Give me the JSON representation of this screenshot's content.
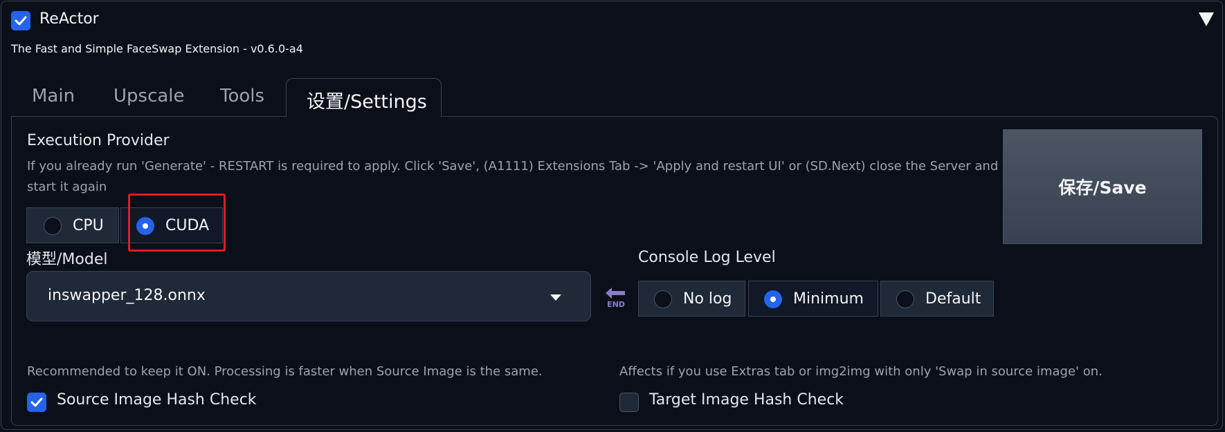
{
  "header": {
    "enabled": true,
    "title": "ReActor",
    "subtitle": "The Fast and Simple FaceSwap Extension - v0.6.0-a4",
    "collapse_icon": "triangle-down-icon"
  },
  "tabs": [
    {
      "label": "Main",
      "active": false
    },
    {
      "label": "Upscale",
      "active": false
    },
    {
      "label": "Tools",
      "active": false
    },
    {
      "label": "设置/Settings",
      "active": true
    }
  ],
  "settings": {
    "execution_provider": {
      "label": "Execution Provider",
      "info": "If you already run 'Generate' - RESTART is required to apply. Click 'Save', (A1111) Extensions Tab -> 'Apply and restart UI' or (SD.Next) close the Server and start it again",
      "options": [
        "CPU",
        "CUDA"
      ],
      "selected": "CUDA"
    },
    "save_button": "保存/Save",
    "model": {
      "label": "模型/Model",
      "value": "inswapper_128.onnx",
      "icon": "chevron-down-icon"
    },
    "end_icon": {
      "name": "end-arrow-icon",
      "text": "END"
    },
    "console_log": {
      "label": "Console Log Level",
      "options": [
        "No log",
        "Minimum",
        "Default"
      ],
      "selected": "Minimum"
    },
    "source_hash": {
      "info": "Recommended to keep it ON. Processing is faster when Source Image is the same.",
      "label": "Source Image Hash Check",
      "checked": true
    },
    "target_hash": {
      "info": "Affects if you use Extras tab or img2img with only 'Swap in source image' on.",
      "label": "Target Image Hash Check",
      "checked": false
    }
  },
  "colors": {
    "accent": "#2563eb",
    "background": "#0b0f19",
    "highlight_box": "#e31b23"
  }
}
